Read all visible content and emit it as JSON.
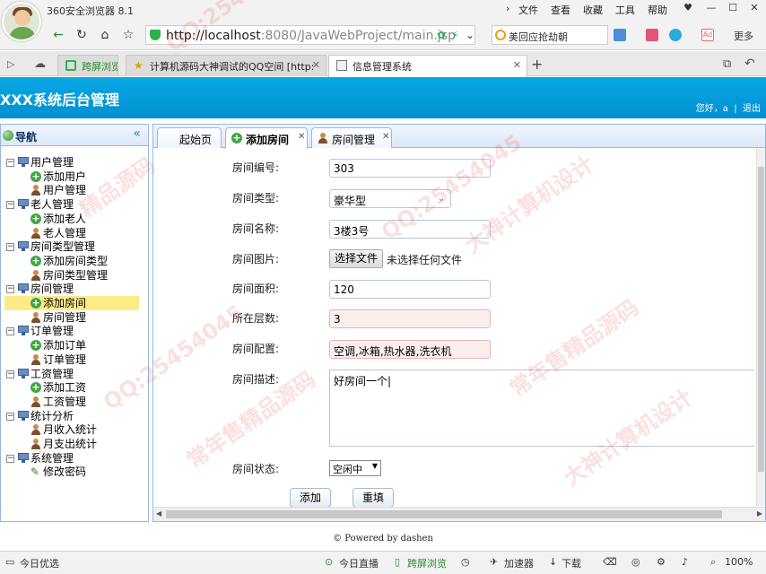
{
  "browser": {
    "app_title": "360安全浏览器 8.1",
    "menu": [
      "文件",
      "查看",
      "收藏",
      "工具",
      "帮助"
    ],
    "url_host": "http://localhost",
    "url_rest": ":8080/JavaWebProject/main.jsp",
    "search_text": "美回应抢劫朝",
    "more_label": "更多",
    "tabs": [
      {
        "label": "跨屏浏览"
      },
      {
        "label": "计算机源码大神调试的QQ空间 [http:"
      },
      {
        "label": "信息管理系统"
      }
    ]
  },
  "header": {
    "title": "XXX系统后台管理",
    "greeting": "您好，a",
    "logout": "退出"
  },
  "nav": {
    "title": "导航",
    "collapse_glyph": "«",
    "groups": [
      {
        "label": "用户管理",
        "children": [
          "添加用户",
          "用户管理"
        ]
      },
      {
        "label": "老人管理",
        "children": [
          "添加老人",
          "老人管理"
        ]
      },
      {
        "label": "房间类型管理",
        "children": [
          "添加房间类型",
          "房间类型管理"
        ]
      },
      {
        "label": "房间管理",
        "children": [
          "添加房间",
          "房间管理"
        ]
      },
      {
        "label": "订单管理",
        "children": [
          "添加订单",
          "订单管理"
        ]
      },
      {
        "label": "工资管理",
        "children": [
          "添加工资",
          "工资管理"
        ]
      },
      {
        "label": "统计分析",
        "children": [
          "月收入统计",
          "月支出统计"
        ]
      },
      {
        "label": "系统管理",
        "children": [
          "修改密码"
        ]
      }
    ]
  },
  "tabs": [
    {
      "label": "起始页"
    },
    {
      "label": "添加房间"
    },
    {
      "label": "房间管理"
    }
  ],
  "form": {
    "room_no_label": "房间编号:",
    "room_no_value": "303",
    "room_type_label": "房间类型:",
    "room_type_value": "豪华型",
    "room_name_label": "房间名称:",
    "room_name_value": "3楼3号",
    "room_photo_label": "房间图片:",
    "file_button": "选择文件",
    "file_status": "未选择任何文件",
    "room_area_label": "房间面积:",
    "room_area_value": "120",
    "floor_label": "所在层数:",
    "floor_value": "3",
    "config_label": "房间配置:",
    "config_value": "空调,冰箱,热水器,洗衣机",
    "desc_label": "房间描述:",
    "desc_value": "好房间一个|",
    "status_label": "房间状态:",
    "status_value": "空闲中",
    "add_button": "添加",
    "reset_button": "重填"
  },
  "footer": {
    "powered": "© Powered by dashen"
  },
  "statusbar": {
    "left": "今日优选",
    "items": [
      "今日直播",
      "跨屏浏览",
      "加速器",
      "下载"
    ],
    "zoom": "100%"
  },
  "watermarks": [
    "QQ:2545404",
    "精品源码",
    "大神计算机设计",
    "常年售精品源码",
    "QQ:25454045",
    "大神计算机设计",
    "QQ:25454045",
    "常年售精品源码"
  ],
  "colors": {
    "header_blue": "#0aa0e0",
    "selected_node": "#fbec88",
    "panel_border": "#95b8e7"
  }
}
